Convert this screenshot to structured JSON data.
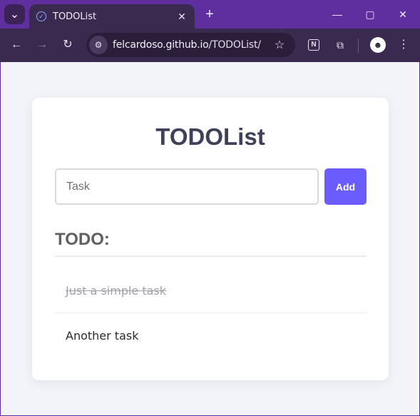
{
  "browser": {
    "tab": {
      "title": "TODOList",
      "favicon": "check-circle-icon"
    },
    "url": {
      "host": "felcardoso.github.io",
      "path": "/TODOList/"
    },
    "icons": {
      "tab_search": "chevron-down-icon",
      "new_tab": "plus-icon",
      "back": "arrow-left-icon",
      "forward": "arrow-right-icon",
      "reload": "reload-icon",
      "site_info": "tune-icon",
      "bookmark": "star-icon",
      "notion": "notion-icon",
      "extensions": "puzzle-icon",
      "profile": "avatar-icon",
      "menu": "more-vertical-icon"
    }
  },
  "page": {
    "title": "TODOList",
    "input": {
      "placeholder": "Task",
      "value": ""
    },
    "add_label": "Add",
    "section_title": "TODO:",
    "tasks": [
      {
        "text": "Just a simple task",
        "done": true
      },
      {
        "text": "Another task",
        "done": false
      }
    ]
  },
  "colors": {
    "tabbar": "#5f2f9f",
    "toolbar": "#3b2a4f",
    "page_bg": "#f2f4f9",
    "title": "#3d4159",
    "accent": "#6b5cff",
    "done_text": "#a0a0a6"
  }
}
